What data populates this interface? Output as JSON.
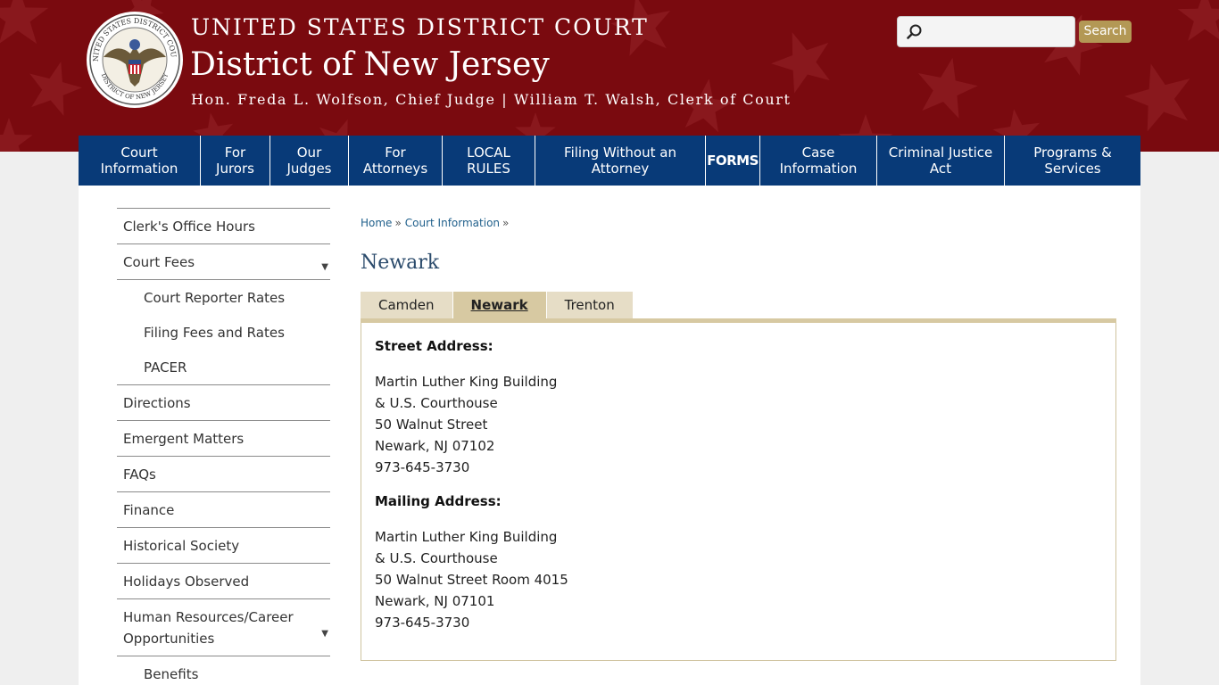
{
  "header": {
    "court_line1": "UNITED STATES DISTRICT COURT",
    "court_line2": "District of New Jersey",
    "court_line3": "Hon. Freda L. Wolfson, Chief Judge | William T. Walsh, Clerk of Court",
    "seal_text_top": "UNITED STATES DISTRICT COURT",
    "seal_text_bottom": "DISTRICT OF NEW JERSEY",
    "search": {
      "placeholder": "",
      "button_label": "Search",
      "icon": "search-icon"
    },
    "colors": {
      "banner": "#7a0a0f",
      "nav": "#083a78",
      "accent": "#b39855"
    }
  },
  "nav": {
    "items": [
      {
        "label1": "Court",
        "label2": "Information"
      },
      {
        "label1": "For",
        "label2": "Jurors"
      },
      {
        "label1": "Our",
        "label2": "Judges"
      },
      {
        "label1": "For",
        "label2": "Attorneys"
      },
      {
        "label1": "LOCAL",
        "label2": "RULES"
      },
      {
        "label1": "Filing Without an",
        "label2": "Attorney"
      },
      {
        "label1": "FORMS",
        "label2": ""
      },
      {
        "label1": "Case",
        "label2": "Information"
      },
      {
        "label1": "Criminal Justice",
        "label2": "Act"
      },
      {
        "label1": "Programs &",
        "label2": "Services"
      }
    ]
  },
  "sidebar": {
    "items": [
      {
        "label": "Clerk's Office Hours"
      },
      {
        "label": "Court Fees",
        "arrow": "▼"
      },
      {
        "label": "Court Reporter Rates"
      },
      {
        "label": "Filing Fees and Rates"
      },
      {
        "label": "PACER"
      },
      {
        "label": "Directions"
      },
      {
        "label": "Emergent Matters"
      },
      {
        "label": "FAQs"
      },
      {
        "label": "Finance"
      },
      {
        "label": "Historical Society"
      },
      {
        "label": "Holidays Observed"
      },
      {
        "label": "Human Resources/Career Opportunities",
        "arrow": "▼"
      },
      {
        "label": "Benefits"
      }
    ]
  },
  "breadcrumb": {
    "home": "Home",
    "section": "Court Information",
    "sep": "»"
  },
  "page_title": "Newark",
  "tabs": [
    {
      "label": "Camden"
    },
    {
      "label": "Newark"
    },
    {
      "label": "Trenton"
    }
  ],
  "newark": {
    "street_heading": "Street Address:",
    "street": [
      "Martin Luther King Building",
      "& U.S. Courthouse",
      "50 Walnut Street",
      "Newark, NJ 07102",
      "973-645-3730"
    ],
    "mailing_heading": "Mailing Address:",
    "mailing": [
      "Martin Luther King Building",
      "& U.S. Courthouse",
      "50 Walnut Street Room 4015",
      "Newark, NJ 07101",
      "973-645-3730"
    ]
  }
}
